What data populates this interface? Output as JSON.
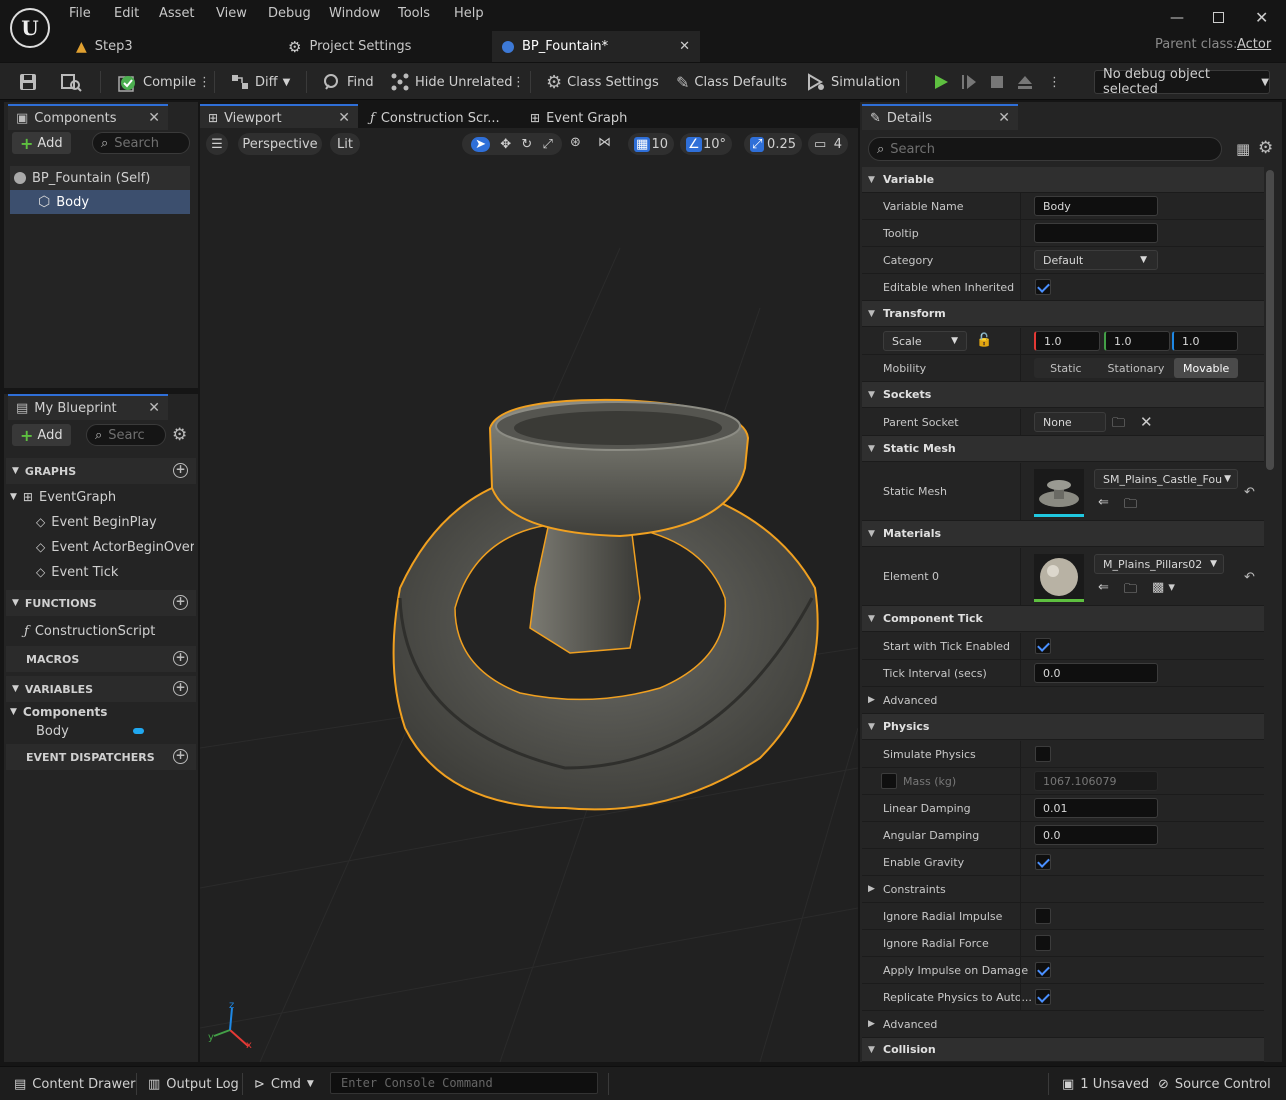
{
  "menu": [
    "File",
    "Edit",
    "Asset",
    "View",
    "Debug",
    "Window",
    "Tools",
    "Help"
  ],
  "doc_tabs": [
    "Step3",
    "Project Settings",
    "BP_Fountain*"
  ],
  "parent_class": {
    "label": "Parent class:",
    "value": "Actor"
  },
  "toolbar": {
    "compile": "Compile",
    "diff": "Diff",
    "find": "Find",
    "hide_unrelated": "Hide Unrelated",
    "class_settings": "Class Settings",
    "class_defaults": "Class Defaults",
    "simulation": "Simulation",
    "debug_object": "No debug object selected"
  },
  "components_panel": {
    "title": "Components",
    "add": "Add",
    "search_placeholder": "Search",
    "tree": [
      "BP_Fountain (Self)",
      "Body"
    ]
  },
  "my_blueprint": {
    "title": "My Blueprint",
    "add": "Add",
    "search_placeholder": "Searc",
    "graphs_header": "GRAPHS",
    "event_graph": "EventGraph",
    "events": [
      "Event BeginPlay",
      "Event ActorBeginOverlap",
      "Event Tick"
    ],
    "functions_header": "FUNCTIONS",
    "construction_script": "ConstructionScript",
    "macros_header": "MACROS",
    "variables_header": "VARIABLES",
    "components_group": "Components",
    "body_var": "Body",
    "dispatchers_header": "EVENT DISPATCHERS"
  },
  "editor_tabs": [
    "Viewport",
    "Construction Scr...",
    "Event Graph"
  ],
  "viewport": {
    "perspective": "Perspective",
    "lit": "Lit",
    "grid_snap": "10",
    "rot_snap": "10°",
    "scale_snap": "0.25",
    "camera_speed": "4"
  },
  "details": {
    "title": "Details",
    "search_placeholder": "Search",
    "variable": {
      "header": "Variable",
      "name_label": "Variable Name",
      "name_value": "Body",
      "tooltip_label": "Tooltip",
      "tooltip_value": "",
      "category_label": "Category",
      "category_value": "Default",
      "editable_label": "Editable when Inherited"
    },
    "transform": {
      "header": "Transform",
      "scale_label": "Scale",
      "scale": [
        "1.0",
        "1.0",
        "1.0"
      ],
      "mobility_label": "Mobility",
      "mobility_options": [
        "Static",
        "Stationary",
        "Movable"
      ],
      "mobility_selected": "Movable"
    },
    "sockets": {
      "header": "Sockets",
      "parent_socket_label": "Parent Socket",
      "parent_socket_value": "None"
    },
    "static_mesh": {
      "header": "Static Mesh",
      "label": "Static Mesh",
      "value": "SM_Plains_Castle_Fou"
    },
    "materials": {
      "header": "Materials",
      "label": "Element 0",
      "value": "M_Plains_Pillars02"
    },
    "component_tick": {
      "header": "Component Tick",
      "start_label": "Start with Tick Enabled",
      "interval_label": "Tick Interval (secs)",
      "interval_value": "0.0",
      "advanced": "Advanced"
    },
    "physics": {
      "header": "Physics",
      "simulate": "Simulate Physics",
      "mass_label": "Mass (kg)",
      "mass_value": "1067.106079",
      "linear_label": "Linear Damping",
      "linear_value": "0.01",
      "angular_label": "Angular Damping",
      "angular_value": "0.0",
      "gravity": "Enable Gravity",
      "constraints": "Constraints",
      "ignore_impulse": "Ignore Radial Impulse",
      "ignore_force": "Ignore Radial Force",
      "apply_impulse": "Apply Impulse on Damage",
      "replicate": "Replicate Physics to Auto...",
      "advanced": "Advanced"
    },
    "collision": {
      "header": "Collision"
    }
  },
  "statusbar": {
    "content_drawer": "Content Drawer",
    "output_log": "Output Log",
    "cmd": "Cmd",
    "console_placeholder": "Enter Console Command",
    "unsaved": "1 Unsaved",
    "source_control": "Source Control"
  },
  "colors": {
    "accent": "#2f6fd8",
    "selection_outline": "#f0a020",
    "play_green": "#5ec040"
  }
}
